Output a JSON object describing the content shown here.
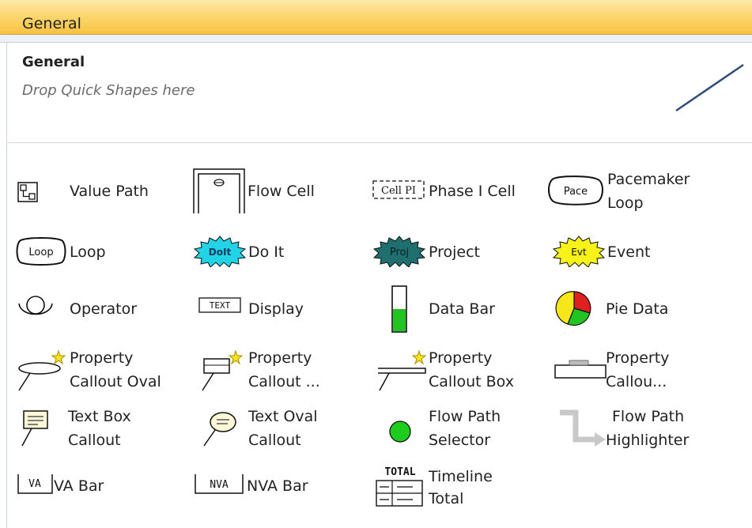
{
  "header": {
    "title": "General"
  },
  "quick_shapes": {
    "title": "General",
    "hint": "Drop Quick Shapes here"
  },
  "shapes": {
    "value_path": {
      "line1": "Value Path",
      "icon": "value-path-icon"
    },
    "flow_cell": {
      "line1": "Flow Cell",
      "icon": "flow-cell-icon"
    },
    "phase1_cell": {
      "line1": "Phase I Cell",
      "icon": "phase-i-cell-icon",
      "icon_text": "Cell PI"
    },
    "pacemaker_loop": {
      "line1": "Pacemaker",
      "line2": "Loop",
      "icon": "pacemaker-loop-icon",
      "icon_text": "Pace"
    },
    "loop": {
      "line1": "Loop",
      "icon": "loop-icon",
      "icon_text": "Loop"
    },
    "do_it": {
      "line1": "Do It",
      "icon": "do-it-burst-icon",
      "icon_text": "DoIt",
      "color": "#22d3e6"
    },
    "project": {
      "line1": "Project",
      "icon": "project-burst-icon",
      "icon_text": "Proj",
      "color": "#1f6f6f"
    },
    "event": {
      "line1": "Event",
      "icon": "event-burst-icon",
      "icon_text": "Evt",
      "color": "#f6f21a"
    },
    "operator": {
      "line1": "Operator",
      "icon": "operator-icon"
    },
    "display": {
      "line1": "Display",
      "icon": "display-icon",
      "icon_text": "TEXT"
    },
    "data_bar": {
      "line1": "Data Bar",
      "icon": "data-bar-icon",
      "color": "#21c421"
    },
    "pie_data": {
      "line1": "Pie Data",
      "icon": "pie-data-icon"
    },
    "property_callout_oval": {
      "line1": "Property",
      "line2": "Callout Oval",
      "icon": "property-callout-oval-icon"
    },
    "property_callout_2": {
      "line1": "Property",
      "line2": "Callout ...",
      "icon": "property-callout-icon"
    },
    "property_callout_box": {
      "line1": "Property",
      "line2": "Callout Box",
      "icon": "property-callout-box-icon"
    },
    "property_callout_4": {
      "line1": "Property",
      "line2": "Callou...",
      "icon": "property-callout-flat-icon"
    },
    "text_box_callout": {
      "line1": "Text Box",
      "line2": "Callout",
      "icon": "text-box-callout-icon"
    },
    "text_oval_callout": {
      "line1": "Text Oval",
      "line2": "Callout",
      "icon": "text-oval-callout-icon"
    },
    "flow_path_selector": {
      "line1": "Flow Path",
      "line2": "Selector",
      "icon": "green-dot-icon",
      "color": "#1ecc1e"
    },
    "flow_path_highlighter": {
      "line1": "Flow Path",
      "line2": "Highlighter",
      "icon": "highlighter-arrow-icon"
    },
    "va_bar": {
      "line1": "VA Bar",
      "icon": "va-bar-icon",
      "icon_text": "VA"
    },
    "nva_bar": {
      "line1": "NVA Bar",
      "icon": "nva-bar-icon",
      "icon_text": "NVA"
    },
    "timeline_total": {
      "line1": "Timeline",
      "line2": "Total",
      "icon": "timeline-total-icon",
      "icon_text": "TOTAL"
    }
  },
  "colors": {
    "header_top": "#fde9a8",
    "header_bottom": "#f7c243",
    "annotation_line": "#2f4c7a"
  }
}
